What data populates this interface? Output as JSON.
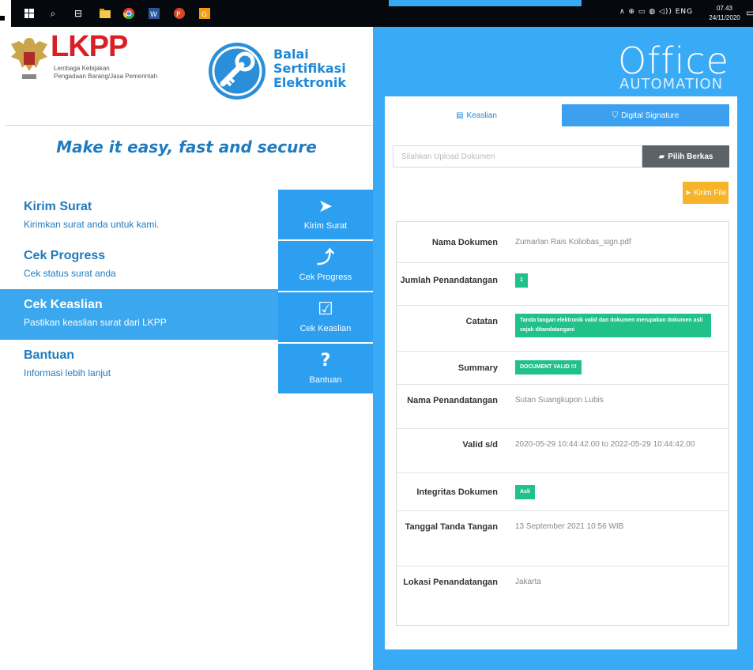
{
  "taskbar": {
    "tray_icons": "∧ ⊕ ▭ ◍ ◁)) ENG",
    "time": "07.43",
    "date": "24/11/2020",
    "icons": [
      "windows-start-icon",
      "search-icon",
      "task-view-icon",
      "file-explorer-icon",
      "chrome-icon",
      "word-icon",
      "powerpoint-icon",
      "app-icon"
    ]
  },
  "header": {
    "lkpp_name": "LKPP",
    "lkpp_sub_1": "Lembaga Kebijakan",
    "lkpp_sub_2": "Pengadaan Barang/Jasa Pemerintah",
    "bse_line1": "Balai",
    "bse_line2": "Sertifikasi",
    "bse_line3": "Elektronik"
  },
  "tagline": "Make it easy, fast and secure",
  "menu": [
    {
      "title": "Kirim Surat",
      "desc": "Kirimkan surat anda untuk kami.",
      "button": "Kirim Surat",
      "icon": "paper-plane-icon",
      "glyph": "➤"
    },
    {
      "title": "Cek Progress",
      "desc": "Cek status surat anda",
      "button": "Cek Progress",
      "icon": "chart-icon",
      "glyph": "⤴"
    },
    {
      "title": "Cek Keaslian",
      "desc": "Pastikan keaslian surat dari LKPP",
      "button": "Cek Keaslian",
      "icon": "checkbox-icon",
      "glyph": "☑"
    },
    {
      "title": "Bantuan",
      "desc": "Informasi lebih lanjut",
      "button": "Bantuan",
      "icon": "question-icon",
      "glyph": "?"
    }
  ],
  "office": {
    "title": "Office",
    "subtitle": "AUTOMATION"
  },
  "tabs": {
    "keaslian": "Keaslian",
    "digital_signature": "Digital Signature"
  },
  "upload": {
    "placeholder": "Silahkan Upload Dokumen",
    "pilih_berkas": "Pilih Berkas",
    "kirim_file": "Kirim File"
  },
  "results": {
    "nama_dokumen_label": "Nama Dokumen",
    "nama_dokumen_value": "Zumarlan Rais Koliobas_sign.pdf",
    "jumlah_label": "Jumlah Penandatangan",
    "jumlah_value": "1",
    "catatan_label": "Catatan",
    "catatan_value": "Tanda tangan elektronik valid dan dokumen merupakan dokumen asli sejak ditandatangani",
    "summary_label": "Summary",
    "summary_value": "DOCUMENT VALID !!!",
    "nama_penandatangan_label": "Nama Penandatangan",
    "nama_penandatangan_value": "Sutan Suangkupon Lubis",
    "valid_label": "Valid s/d",
    "valid_value": "2020-05-29 10:44:42.00 to 2022-05-29 10:44:42.00",
    "integritas_label": "Integritas Dokumen",
    "integritas_value": "Asli",
    "tanggal_label": "Tanggal Tanda Tangan",
    "tanggal_value": "13 September 2021 10:56 WIB",
    "lokasi_label": "Lokasi Penandatangan",
    "lokasi_value": "Jakarta"
  },
  "colors": {
    "accent_blue": "#39aaf5",
    "brand_red": "#d81f26",
    "success_green": "#21c18a",
    "warning_orange": "#f6b428"
  }
}
